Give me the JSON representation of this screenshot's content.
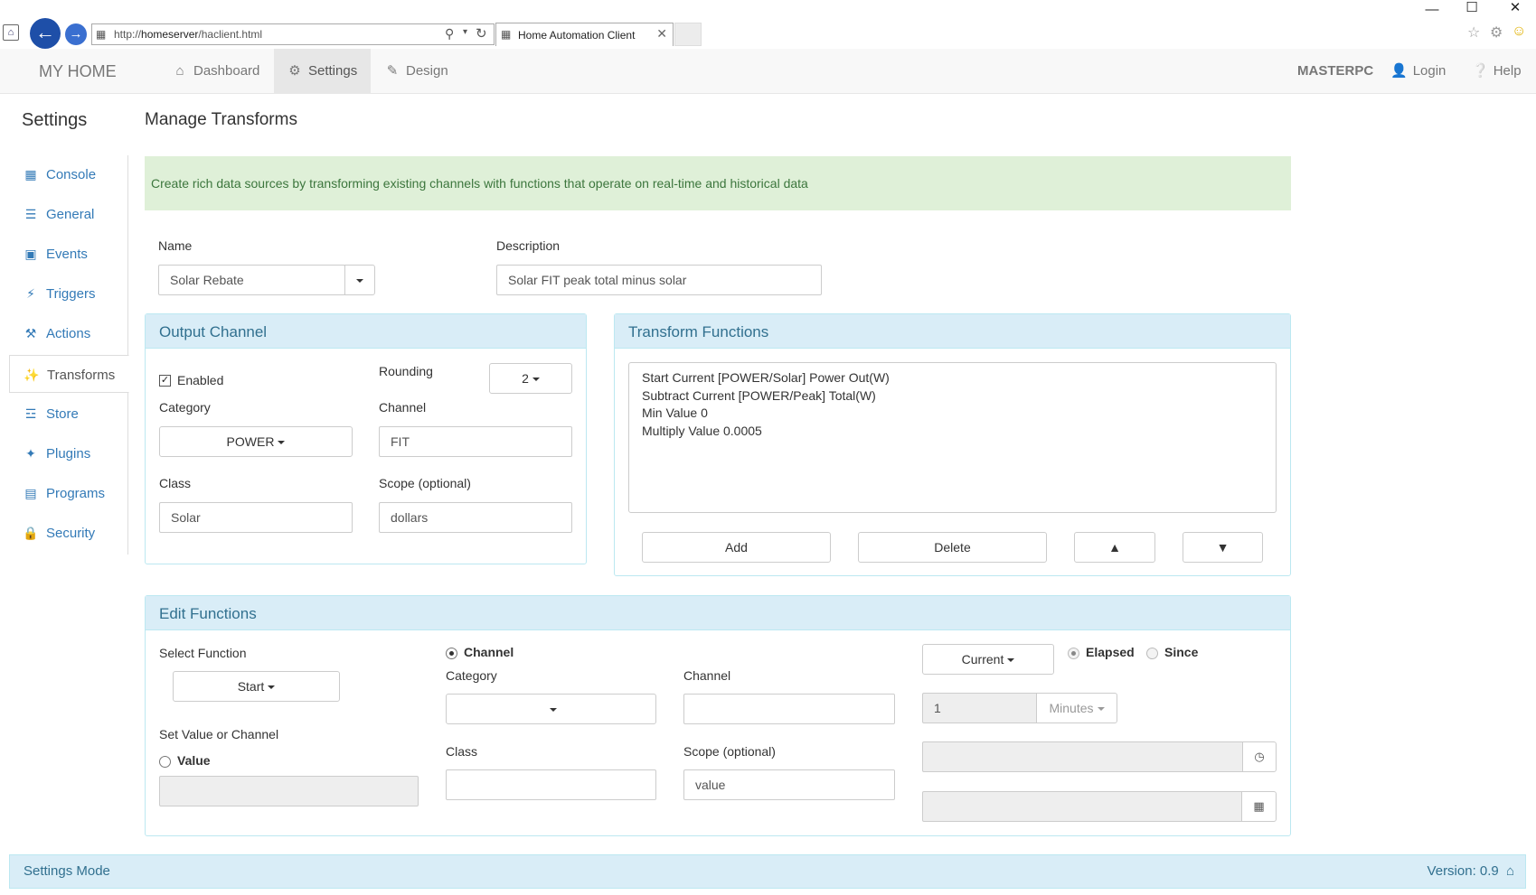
{
  "browser": {
    "url_prefix": "http://",
    "url_host": "homeserver",
    "url_path": "/haclient.html",
    "tab_title": "Home Automation Client"
  },
  "navbar": {
    "brand": "MY HOME",
    "items": [
      {
        "label": "Dashboard",
        "icon": "home-icon"
      },
      {
        "label": "Settings",
        "icon": "gear-icon"
      },
      {
        "label": "Design",
        "icon": "pencil-icon"
      }
    ],
    "machine": "MASTERPC",
    "login": "Login",
    "help": "Help"
  },
  "sidebar": {
    "title": "Settings",
    "items": [
      {
        "label": "Console",
        "icon": "table-icon"
      },
      {
        "label": "General",
        "icon": "sliders-icon"
      },
      {
        "label": "Events",
        "icon": "calendar-icon"
      },
      {
        "label": "Triggers",
        "icon": "bolt-icon"
      },
      {
        "label": "Actions",
        "icon": "wrench-icon"
      },
      {
        "label": "Transforms",
        "icon": "magic-wand-icon"
      },
      {
        "label": "Store",
        "icon": "cart-icon"
      },
      {
        "label": "Plugins",
        "icon": "puzzle-icon"
      },
      {
        "label": "Programs",
        "icon": "file-code-icon"
      },
      {
        "label": "Security",
        "icon": "lock-icon"
      }
    ],
    "active": "Transforms"
  },
  "main": {
    "title": "Manage Transforms",
    "alert": "Create rich data sources by transforming existing channels with functions that operate on real-time and historical data",
    "name_label": "Name",
    "name_value": "Solar Rebate",
    "description_label": "Description",
    "description_value": "Solar FIT peak total minus solar"
  },
  "output_channel": {
    "heading": "Output Channel",
    "enabled_label": "Enabled",
    "enabled": true,
    "rounding_label": "Rounding",
    "rounding_value": "2",
    "category_label": "Category",
    "category_value": "POWER",
    "channel_label": "Channel",
    "channel_value": "FIT",
    "class_label": "Class",
    "class_value": "Solar",
    "scope_label": "Scope (optional)",
    "scope_value": "dollars"
  },
  "transform_functions": {
    "heading": "Transform Functions",
    "lines": [
      "Start Current [POWER/Solar] Power Out(W)",
      "Subtract Current [POWER/Peak] Total(W)",
      "Min Value 0",
      "Multiply Value 0.0005"
    ],
    "add_label": "Add",
    "delete_label": "Delete",
    "up_label": "▲",
    "down_label": "▼"
  },
  "edit_functions": {
    "heading": "Edit Functions",
    "select_function_label": "Select Function",
    "select_function_value": "Start",
    "set_value_label": "Set Value or Channel",
    "value_radio_label": "Value",
    "channel_radio_label": "Channel",
    "category_label": "Category",
    "category_value": "",
    "channel_label": "Channel",
    "channel_value": "",
    "class_label": "Class",
    "class_value": "",
    "scope_label": "Scope (optional)",
    "scope_value": "value",
    "mode_value": "Current",
    "elapsed_label": "Elapsed",
    "since_label": "Since",
    "period_value": "1",
    "period_unit": "Minutes"
  },
  "footer": {
    "mode": "Settings Mode",
    "version": "Version: 0.9"
  }
}
